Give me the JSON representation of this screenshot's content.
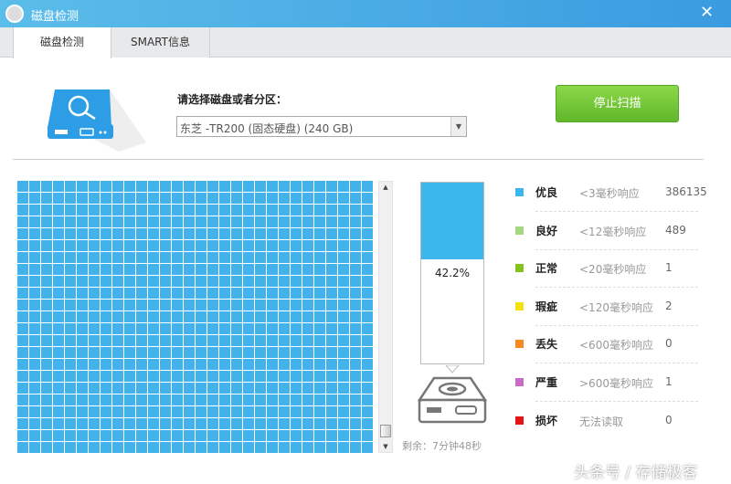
{
  "window": {
    "title": "磁盘检测",
    "close": "✕"
  },
  "tabs": [
    {
      "label": "磁盘检测"
    },
    {
      "label": "SMART信息"
    }
  ],
  "select": {
    "label": "请选择磁盘或者分区：",
    "value": "东芝 -TR200 (固态硬盘)  (240 GB)"
  },
  "stop_button": "停止扫描",
  "grid": {
    "columns": 30,
    "rows": 23,
    "color": "#42b3ea"
  },
  "progress": {
    "percent": 42.2,
    "label": "42.2%",
    "remaining": "剩余：7分钟48秒"
  },
  "legend": [
    {
      "name": "优良",
      "range": "<3毫秒响应",
      "count": "386135",
      "color": "#3bb7ee"
    },
    {
      "name": "良好",
      "range": "<12毫秒响应",
      "count": "489",
      "color": "#a5d97f"
    },
    {
      "name": "正常",
      "range": "<20毫秒响应",
      "count": "1",
      "color": "#84c21a"
    },
    {
      "name": "瑕疵",
      "range": "<120毫秒响应",
      "count": "2",
      "color": "#f2e20c"
    },
    {
      "name": "丢失",
      "range": "<600毫秒响应",
      "count": "0",
      "color": "#f58a1f"
    },
    {
      "name": "严重",
      "range": ">600毫秒响应",
      "count": "1",
      "color": "#c86ac8"
    },
    {
      "name": "损坏",
      "range": "无法读取",
      "count": "0",
      "color": "#e31414"
    }
  ],
  "watermark": "头条号 / 存储极客"
}
